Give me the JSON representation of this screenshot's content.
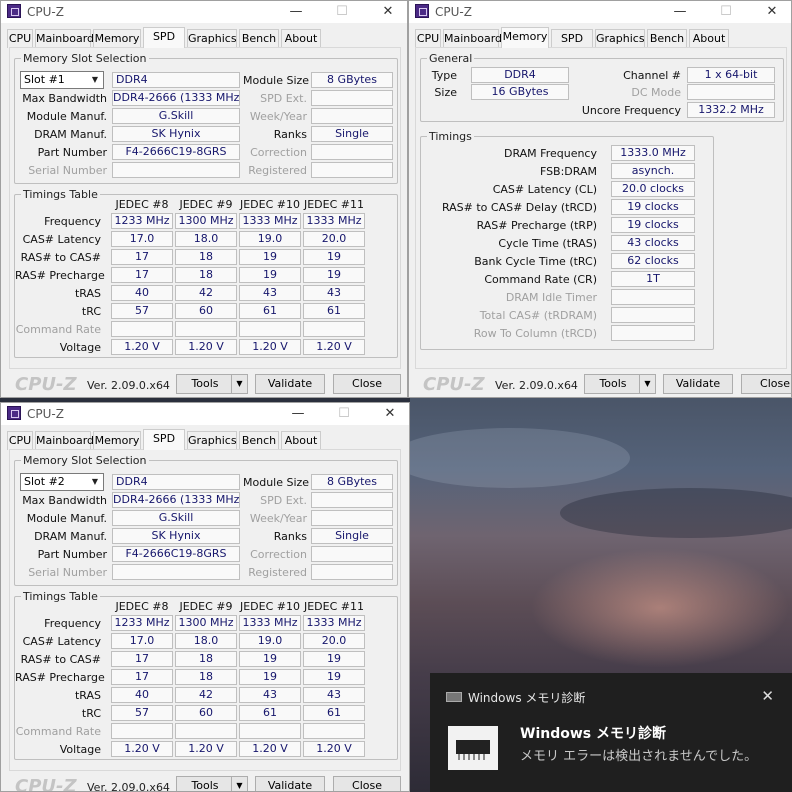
{
  "app": {
    "title": "CPU-Z",
    "logo": "CPU-Z",
    "version": "Ver. 2.09.0.x64"
  },
  "tabs": [
    "CPU",
    "Mainboard",
    "Memory",
    "SPD",
    "Graphics",
    "Bench",
    "About"
  ],
  "buttons": {
    "tools": "Tools",
    "validate": "Validate",
    "close": "Close"
  },
  "spd_labels": {
    "group_slot": "Memory Slot Selection",
    "module_size": "Module Size",
    "max_bandwidth": "Max Bandwidth",
    "spd_ext": "SPD Ext.",
    "module_manuf": "Module Manuf.",
    "week_year": "Week/Year",
    "dram_manuf": "DRAM Manuf.",
    "ranks": "Ranks",
    "part_number": "Part Number",
    "correction": "Correction",
    "serial_number": "Serial Number",
    "registered": "Registered",
    "group_timings": "Timings Table",
    "rows": [
      "Frequency",
      "CAS# Latency",
      "RAS# to CAS#",
      "RAS# Precharge",
      "tRAS",
      "tRC",
      "Command Rate",
      "Voltage"
    ]
  },
  "spd_windows": [
    {
      "slot": "Slot #1",
      "type": "DDR4",
      "module_size": "8 GBytes",
      "max_bandwidth": "DDR4-2666 (1333 MHz)",
      "module_manuf": "G.Skill",
      "dram_manuf": "SK Hynix",
      "ranks": "Single",
      "part_number": "F4-2666C19-8GRS",
      "timings": {
        "headers": [
          "JEDEC #8",
          "JEDEC #9",
          "JEDEC #10",
          "JEDEC #11"
        ],
        "cols": [
          [
            "1233 MHz",
            "17.0",
            "17",
            "17",
            "40",
            "57",
            "",
            "1.20 V"
          ],
          [
            "1300 MHz",
            "18.0",
            "18",
            "18",
            "42",
            "60",
            "",
            "1.20 V"
          ],
          [
            "1333 MHz",
            "19.0",
            "19",
            "19",
            "43",
            "61",
            "",
            "1.20 V"
          ],
          [
            "1333 MHz",
            "20.0",
            "19",
            "19",
            "43",
            "61",
            "",
            "1.20 V"
          ]
        ]
      }
    },
    {
      "slot": "Slot #2",
      "type": "DDR4",
      "module_size": "8 GBytes",
      "max_bandwidth": "DDR4-2666 (1333 MHz)",
      "module_manuf": "G.Skill",
      "dram_manuf": "SK Hynix",
      "ranks": "Single",
      "part_number": "F4-2666C19-8GRS",
      "timings": {
        "headers": [
          "JEDEC #8",
          "JEDEC #9",
          "JEDEC #10",
          "JEDEC #11"
        ],
        "cols": [
          [
            "1233 MHz",
            "17.0",
            "17",
            "17",
            "40",
            "57",
            "",
            "1.20 V"
          ],
          [
            "1300 MHz",
            "18.0",
            "18",
            "18",
            "42",
            "60",
            "",
            "1.20 V"
          ],
          [
            "1333 MHz",
            "19.0",
            "19",
            "19",
            "43",
            "61",
            "",
            "1.20 V"
          ],
          [
            "1333 MHz",
            "20.0",
            "19",
            "19",
            "43",
            "61",
            "",
            "1.20 V"
          ]
        ]
      }
    }
  ],
  "memory": {
    "group_general": "General",
    "type_label": "Type",
    "type": "DDR4",
    "channel_label": "Channel #",
    "channel": "1 x 64-bit",
    "size_label": "Size",
    "size": "16 GBytes",
    "dc_mode_label": "DC Mode",
    "uncore_label": "Uncore Frequency",
    "uncore": "1332.2 MHz",
    "group_timings": "Timings",
    "timings": [
      {
        "label": "DRAM Frequency",
        "value": "1333.0 MHz",
        "dim": false
      },
      {
        "label": "FSB:DRAM",
        "value": "asynch.",
        "dim": false
      },
      {
        "label": "CAS# Latency (CL)",
        "value": "20.0 clocks",
        "dim": false
      },
      {
        "label": "RAS# to CAS# Delay (tRCD)",
        "value": "19 clocks",
        "dim": false
      },
      {
        "label": "RAS# Precharge (tRP)",
        "value": "19 clocks",
        "dim": false
      },
      {
        "label": "Cycle Time (tRAS)",
        "value": "43 clocks",
        "dim": false
      },
      {
        "label": "Bank Cycle Time (tRC)",
        "value": "62 clocks",
        "dim": false
      },
      {
        "label": "Command Rate (CR)",
        "value": "1T",
        "dim": false
      },
      {
        "label": "DRAM Idle Timer",
        "value": "",
        "dim": true
      },
      {
        "label": "Total CAS# (tRDRAM)",
        "value": "",
        "dim": true
      },
      {
        "label": "Row To Column (tRCD)",
        "value": "",
        "dim": true
      }
    ]
  },
  "toast": {
    "app_name": "Windows メモリ診断",
    "title": "Windows メモリ診断",
    "message": "メモリ エラーは検出されませんでした。"
  },
  "icons": {
    "close": "close-icon",
    "minimize": "minimize-icon",
    "maximize": "maximize-icon",
    "dropdown": "chevron-down-icon"
  }
}
